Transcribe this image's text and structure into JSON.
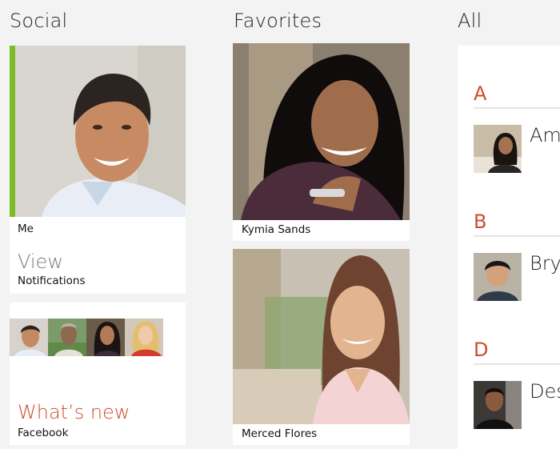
{
  "sections": {
    "social": "Social",
    "favorites": "Favorites",
    "all": "All"
  },
  "me_tile": {
    "label": "Me",
    "action_title": "View",
    "action_subtitle": "Notifications"
  },
  "whats_new_tile": {
    "title": "What’s new",
    "subtitle": "Facebook"
  },
  "favorites": [
    {
      "name": "Kymia Sands"
    },
    {
      "name": "Merced Flores"
    }
  ],
  "all_list": {
    "groups": [
      {
        "letter": "A",
        "name": "Am"
      },
      {
        "letter": "B",
        "name": "Bry"
      },
      {
        "letter": "D",
        "name": "Des"
      }
    ]
  },
  "colors": {
    "accent_green": "#7cbb2a",
    "accent_orange": "#cf4b2a",
    "background": "#f3f3f3"
  }
}
